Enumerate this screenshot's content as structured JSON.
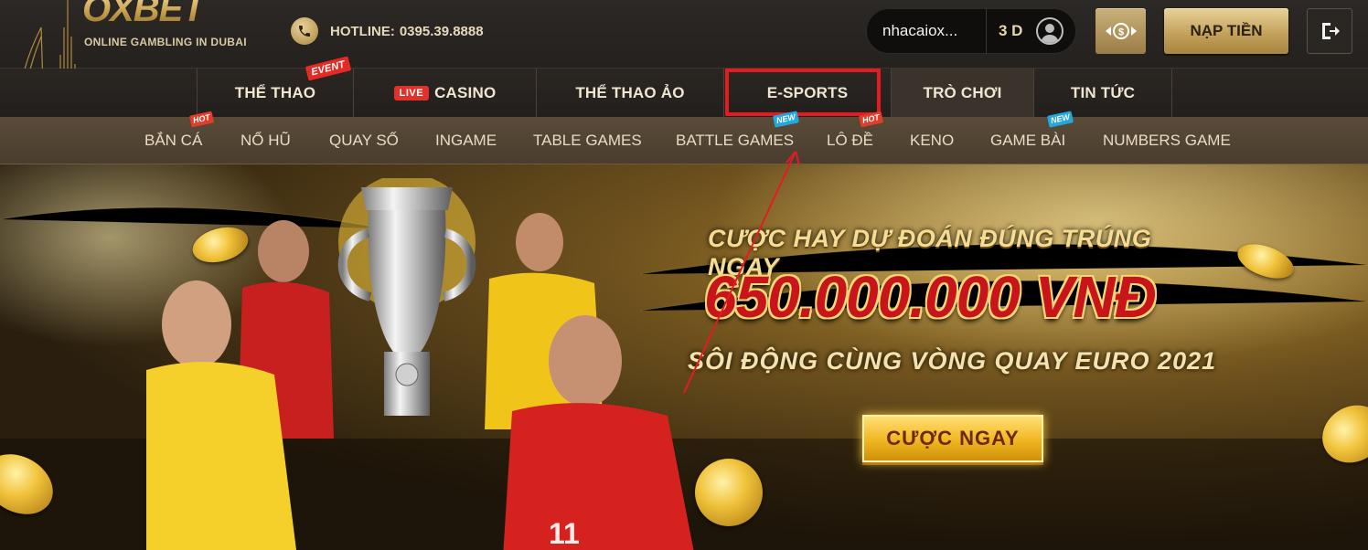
{
  "brand": {
    "logo_text": "OXBET",
    "tagline": "ONLINE GAMBLING IN DUBAI"
  },
  "hotline": {
    "label": "HOTLINE:",
    "number": "0395.39.8888"
  },
  "user": {
    "name": "nhacaiox...",
    "balance": "3 D"
  },
  "actions": {
    "deposit_label": "NẠP TIỀN"
  },
  "main_nav": {
    "items": [
      {
        "label": "THỂ THAO",
        "badge": "EVENT"
      },
      {
        "label": "CASINO",
        "badge": "LIVE"
      },
      {
        "label": "THỂ THAO ẢO"
      },
      {
        "label": "E-SPORTS"
      },
      {
        "label": "TRÒ CHƠI"
      },
      {
        "label": "TIN TỨC"
      }
    ]
  },
  "sub_nav": {
    "items": [
      {
        "label": "BẮN CÁ",
        "badge": "HOT"
      },
      {
        "label": "NỔ HŨ"
      },
      {
        "label": "QUAY SỐ"
      },
      {
        "label": "INGAME"
      },
      {
        "label": "TABLE GAMES"
      },
      {
        "label": "BATTLE GAMES",
        "badge": "NEW"
      },
      {
        "label": "LÔ ĐỀ",
        "badge": "HOT"
      },
      {
        "label": "KENO"
      },
      {
        "label": "GAME BÀI",
        "badge": "NEW"
      },
      {
        "label": "NUMBERS GAME"
      }
    ]
  },
  "banner": {
    "headline": "CƯỢC HAY DỰ ĐOÁN ĐÚNG TRÚNG NGAY",
    "prize": "650.000.000 VNĐ",
    "subheadline": "SÔI ĐỘNG CÙNG VÒNG QUAY EURO 2021",
    "cta": "CƯỢC NGAY"
  },
  "colors": {
    "gold": "#c9a24f",
    "highlight_red": "#e31b23",
    "badge_red": "#e23c2a",
    "badge_blue": "#22a7df"
  }
}
